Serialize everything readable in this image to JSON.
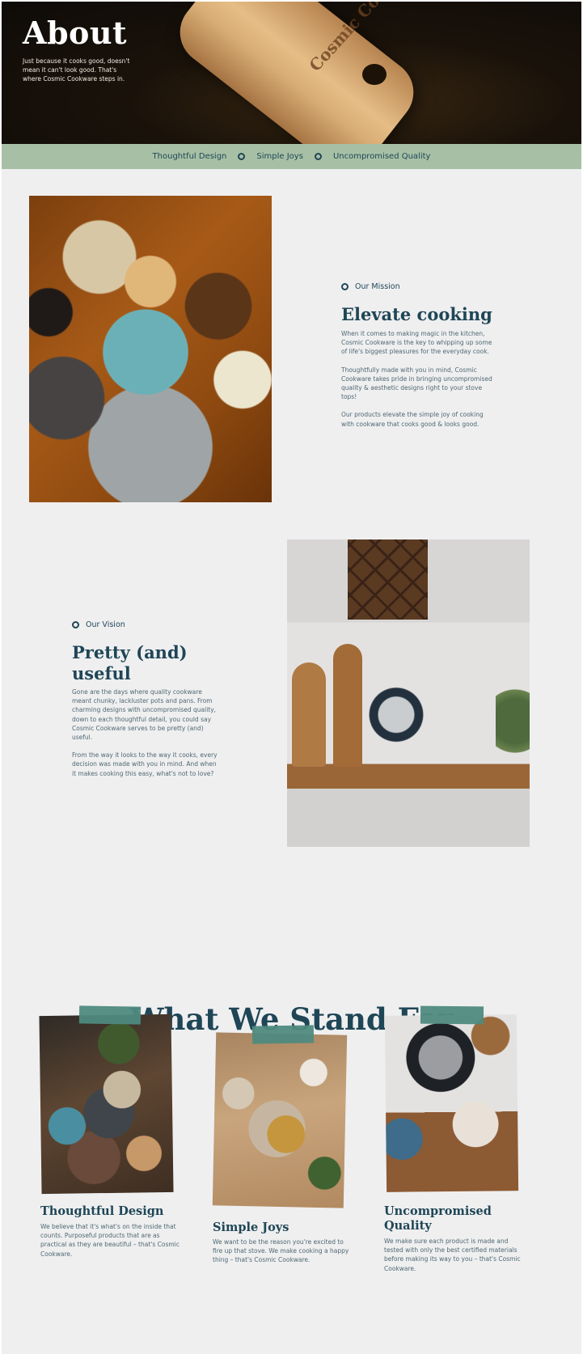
{
  "hero": {
    "title": "About",
    "subtitle": "Just because it cooks good, doesn't mean it can't look good. That's where Cosmic Cookware steps in.",
    "spoon_engraving": "Cosmic Cookware"
  },
  "band": {
    "items": [
      "Thoughtful Design",
      "Simple Joys",
      "Uncompromised Quality"
    ]
  },
  "mission": {
    "eyebrow": "Our Mission",
    "title": "Elevate cooking",
    "paragraphs": [
      "When it comes to making magic in the kitchen, Cosmic Cookware is the key to whipping up some of life's biggest pleasures for the everyday cook.",
      "Thoughtfully made with you in mind, Cosmic Cookware takes pride in bringing uncompromised quality & aesthetic designs right to your stove tops!",
      "Our products elevate the simple joy of cooking with cookware that cooks good & looks good."
    ]
  },
  "vision": {
    "eyebrow": "Our Vision",
    "title": "Pretty (and) useful",
    "paragraphs": [
      "Gone are the days where quality cookware meant chunky, lackluster pots and pans. From charming designs with uncompromised quality, down to each thoughtful detail, you could say Cosmic Cookware serves to be pretty (and) useful.",
      "From the way it looks to the way it cooks, every decision was made with you in mind. And when it makes cooking this easy, what's not to love?"
    ]
  },
  "stand_for": {
    "title": "What We Stand For",
    "cards": [
      {
        "title": "Thoughtful Design",
        "text": "We believe that it's what's on the inside that counts. Purposeful products that are as practical as they are beautiful – that's Cosmic Cookware."
      },
      {
        "title": "Simple Joys",
        "text": "We want to be the reason you're excited to fire up that stove. We make cooking a happy thing – that's Cosmic Cookware."
      },
      {
        "title": "Uncompromised Quality",
        "text": "We make sure each product is made and tested with only the best certified materials before making its way to you – that's Cosmic Cookware."
      }
    ]
  },
  "colors": {
    "primary": "#1f4656",
    "band": "#a7c0a5",
    "page_bg": "#efeff0",
    "tape": "#4f8a7e"
  }
}
